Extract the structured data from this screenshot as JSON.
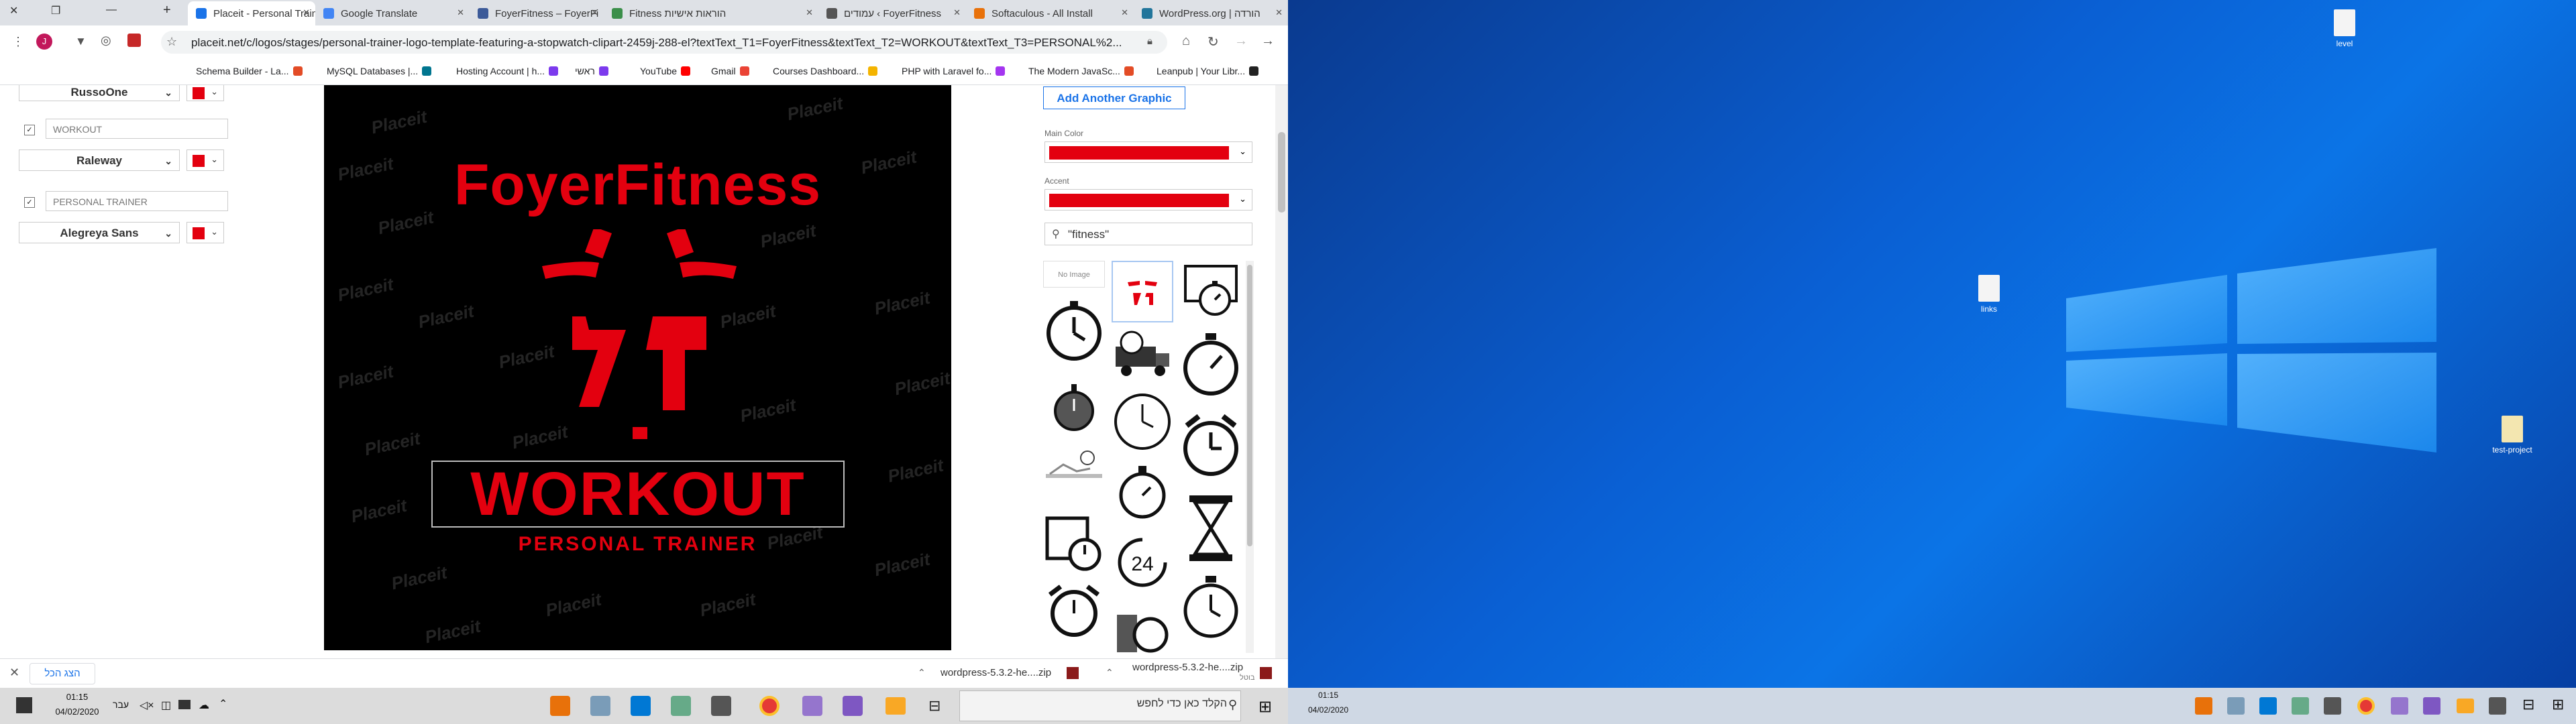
{
  "browser": {
    "tabs": [
      {
        "title": "Placeit - Personal Train",
        "color": "#1a73e8",
        "active": true
      },
      {
        "title": "Google Translate",
        "color": "#4285f4"
      },
      {
        "title": "FoyerFitness – FoyerFi",
        "color": "#3c5a99"
      },
      {
        "title": "Fitness הוראות אישיות",
        "color": "#3b8f4a"
      },
      {
        "title": "עמודים ‹ FoyerFitness",
        "color": "#555555"
      },
      {
        "title": "Softaculous - All Install",
        "color": "#e8710a"
      },
      {
        "title": "WordPress.org | הורדה",
        "color": "#21759b"
      }
    ],
    "new_tab": "+",
    "url": "placeit.net/c/logos/stages/personal-trainer-logo-template-featuring-a-stopwatch-clipart-2459j-288-el?textText_T1=FoyerFitness&textText_T2=WORKOUT&textText_T3=PERSONAL%2...",
    "profile_initial": "J",
    "bookmarks": [
      {
        "label": "Schema Builder - La...",
        "color": "#e34c26"
      },
      {
        "label": "MySQL Databases |...",
        "color": "#00758f"
      },
      {
        "label": "Hosting Account | h...",
        "color": "#7c3aed"
      },
      {
        "label": "ראשי",
        "color": "#7c3aed"
      },
      {
        "label": "YouTube",
        "color": "#ff0000"
      },
      {
        "label": "Gmail",
        "color": "#ea4335"
      },
      {
        "label": "Courses Dashboard...",
        "color": "#f4b400"
      },
      {
        "label": "PHP with Laravel fo...",
        "color": "#a435f0"
      },
      {
        "label": "The Modern JavaSc...",
        "color": "#e34c26"
      },
      {
        "label": "Leanpub | Your Libr...",
        "color": "#222222"
      }
    ]
  },
  "editor": {
    "left_fields": [
      {
        "text": "",
        "font": "RussoOne",
        "checked": true
      },
      {
        "text": "WORKOUT",
        "font": "Raleway",
        "checked": true
      },
      {
        "text": "PERSONAL TRAINER",
        "font": "Alegreya Sans",
        "checked": true
      }
    ],
    "logo": {
      "title": "FoyerFitness",
      "main": "WORKOUT",
      "sub": "PERSONAL TRAINER",
      "watermark": "Placeit"
    },
    "right": {
      "add_graphic": "Add Another Graphic",
      "main_color_label": "Main Color",
      "accent_label": "Accent",
      "search_value": "\"fitness\"",
      "no_image": "No Image"
    }
  },
  "downloads": {
    "show_all": "הצג הכל",
    "items": [
      "wordpress-5.3.2-he....zip",
      "wordpress-5.3.2-he....zip"
    ],
    "item_sub": "בוטל"
  },
  "taskbar_left": {
    "time": "01:15",
    "date": "04/02/2020",
    "lang": "עבר",
    "search_placeholder": "הקלד כאן כדי לחפש"
  },
  "desktop": {
    "icons": [
      {
        "label": "level"
      },
      {
        "label": "links"
      },
      {
        "label": "test-project"
      }
    ],
    "taskbar_time": "01:15",
    "taskbar_date": "04/02/2020"
  },
  "colors": {
    "accent_red": "#e3000f"
  }
}
